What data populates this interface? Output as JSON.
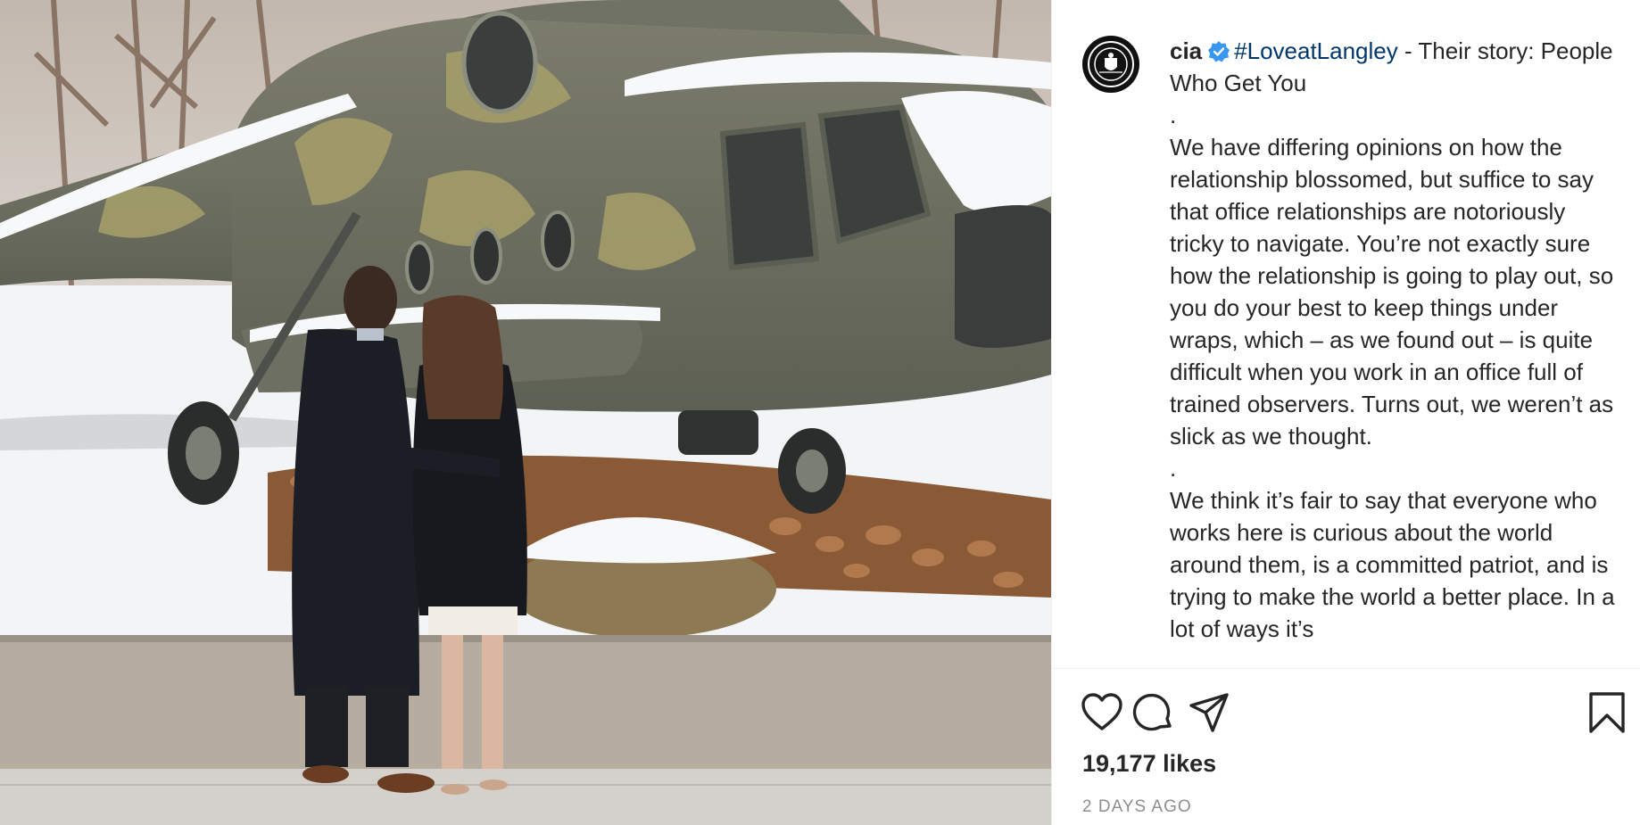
{
  "post": {
    "username": "cia",
    "hashtag": "#LoveatLangley",
    "intro_rest": " - Their story: People Who Get You",
    "separator": ".",
    "paragraph_1": "We have differing opinions on how the relationship blossomed, but suffice to say that office relationships are notoriously tricky to navigate. You’re not exactly sure how the relationship is going to play out, so you do your best to keep things under wraps, which – as we found out – is quite difficult when you work in an office full of trained observers. Turns out, we weren’t as slick as we thought.",
    "paragraph_2": "We think it’s fair to say that everyone who works here is curious about the world around them, is a committed patriot, and is trying to make the world a better place. In a lot of ways it’s"
  },
  "stats": {
    "likes": "19,177 likes",
    "timestamp": "2 DAYS AGO"
  },
  "icons": {
    "avatar": "cia-seal-icon",
    "verified": "verified-badge-icon",
    "like": "heart-icon",
    "comment": "comment-bubble-icon",
    "share": "paper-plane-icon",
    "save": "bookmark-icon"
  },
  "colors": {
    "hashtag": "#00376b",
    "verified_badge": "#3897f0",
    "text": "#262626",
    "muted": "#8e8e8e"
  }
}
